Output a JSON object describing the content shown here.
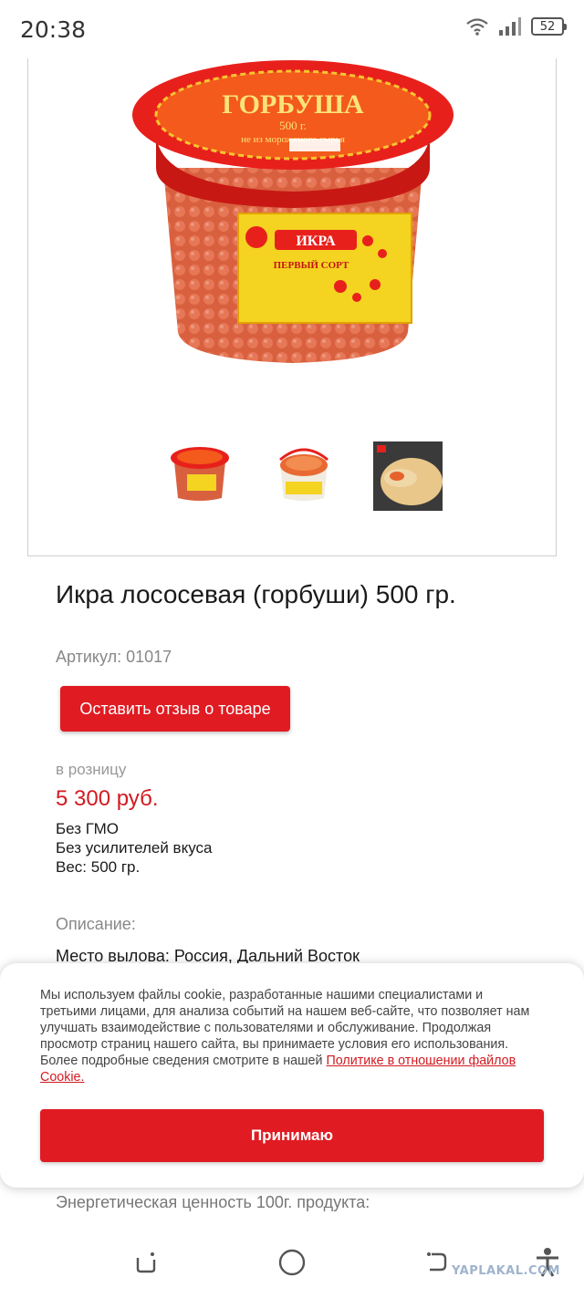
{
  "status": {
    "time": "20:38",
    "battery": "52",
    "icons": [
      "wifi-icon",
      "signal-icon",
      "battery-icon"
    ]
  },
  "product": {
    "photo_label": {
      "brand": "ГОРБУША",
      "weight": "500 г.",
      "note": "не из мороженого сырья",
      "sticker_title": "ИКРА",
      "sticker_sub": "ПЕРВЫЙ СОРТ"
    },
    "title": "Икра лососевая (горбуши) 500 гр.",
    "sku": "Артикул: 01017",
    "review_button": "Оставить отзыв о товаре",
    "retail_label": "в розницу",
    "price": "5 300 руб.",
    "features": [
      "Без ГМО",
      "Без усилителей вкуса",
      "Вес: 500 гр."
    ],
    "description_label": "Описание:",
    "description_line": "Место вылова: Россия, Дальний Восток",
    "energy_label": "Энергетическая ценность 100г. продукта:"
  },
  "cookie": {
    "text": "Мы используем файлы cookie, разработанные нашими специалистами и третьими лицами, для анализа событий на нашем веб-сайте, что позволяет нам улучшать взаимодействие с пользователями и обслуживание. Продолжая просмотр страниц нашего сайта, вы принимаете условия его использования. Более подробные сведения смотрите в нашей ",
    "link": "Политике в отношении файлов Cookie.",
    "accept": "Принимаю"
  },
  "watermark": "YAPLAKAL.COM",
  "colors": {
    "accent": "#e01b22",
    "price": "#d21a21",
    "jar_lid": "#e8201c",
    "caviar": "#d9603f",
    "label_yellow": "#f4d321"
  }
}
